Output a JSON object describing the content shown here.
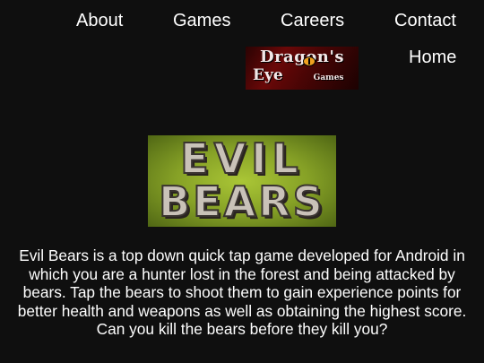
{
  "nav": {
    "about": "About",
    "games": "Games",
    "careers": "Careers",
    "contact": "Contact",
    "home": "Home"
  },
  "logo": {
    "title": "Dragon's",
    "eye": "Eye",
    "games": "Games"
  },
  "banner": {
    "line1": "EVIL",
    "line2": "BEARS"
  },
  "description": "Evil Bears is a top down quick tap game developed for Android in which you are a hunter lost in the forest and being attacked by bears. Tap the bears to shoot them to gain experience points for better health and weapons as well as obtaining the highest score. Can you kill the bears before they kill you?",
  "colors": {
    "background": "#0f0f0f",
    "text": "#ffffff",
    "logo_red": "#6a0808",
    "banner_green": "#86a126"
  }
}
